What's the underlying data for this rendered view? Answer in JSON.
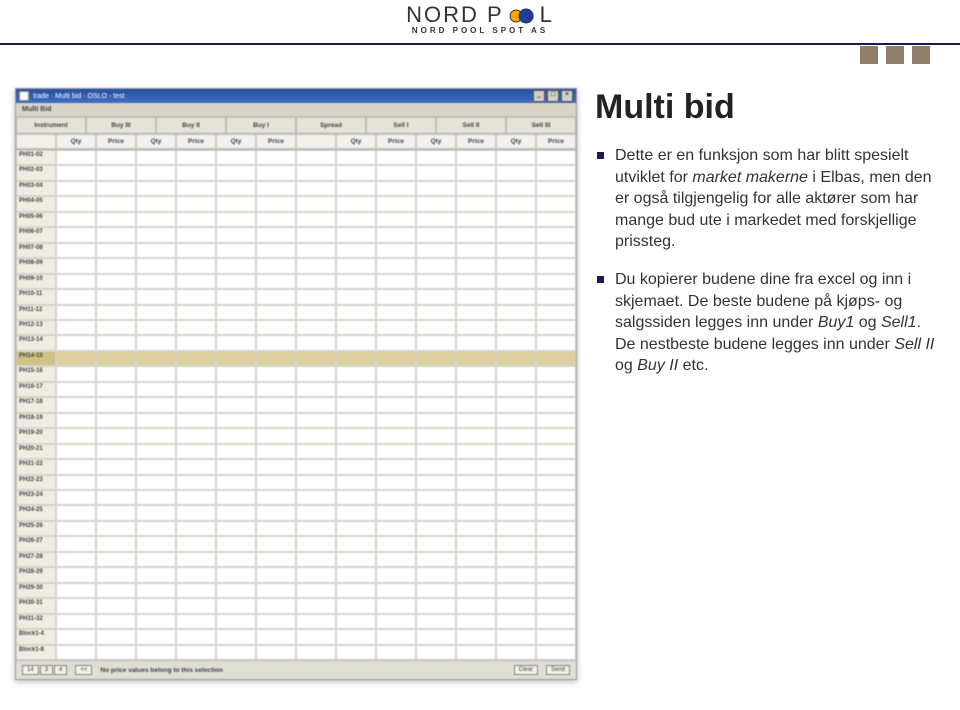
{
  "brand": {
    "name": "NORD POOL",
    "subtitle": "NORD POOL SPOT AS"
  },
  "app": {
    "title": "trade · Multi bid · OSLO - test",
    "menu": "Multi Bid",
    "headers": [
      "Instrument",
      "Buy III",
      "Buy II",
      "Buy I",
      "Spread",
      "Sell I",
      "Sell II",
      "Sell III"
    ],
    "subhead": [
      "",
      "Qty",
      "Price",
      "Qty",
      "Price",
      "Qty",
      "Price",
      "",
      "Qty",
      "Price",
      "Qty",
      "Price",
      "Qty",
      "Price"
    ],
    "rows": [
      "PH01-02",
      "PH02-03",
      "PH03-04",
      "PH04-05",
      "PH05-06",
      "PH06-07",
      "PH07-08",
      "PH08-09",
      "PH09-10",
      "PH10-11",
      "PH11-12",
      "PH12-13",
      "PH13-14",
      "PH14-15",
      "PH15-16",
      "PH16-17",
      "PH17-18",
      "PH18-19",
      "PH19-20",
      "PH20-21",
      "PH21-22",
      "PH22-23",
      "PH23-24",
      "PH24-25",
      "PH25-26",
      "PH26-27",
      "PH27-28",
      "PH28-29",
      "PH29-30",
      "PH30-31",
      "PH31-32",
      "Block1-4",
      "Block1-8"
    ],
    "highlight_index": 13,
    "footer_btns": [
      "14",
      "3",
      "4"
    ],
    "footer_msg": "No price values belong to this selection",
    "footer_right": "Clear",
    "footer_right2": "Send"
  },
  "body": {
    "title": "Multi bid",
    "para1_a": "Dette er en funksjon som har blitt spesielt utviklet for ",
    "para1_em1": "market makerne",
    "para1_b": " i Elbas, men den er også tilgjengelig for alle aktører som har mange bud ute i markedet med forskjellige prissteg.",
    "para2_a": "Du kopierer budene dine fra excel og inn i skjemaet. De beste budene på kjøps- og salgssiden legges inn under ",
    "para2_em2a": "Buy1",
    "para2_mid": " og ",
    "para2_em2b": "Sell1",
    "para2_b": ". De nestbeste budene legges inn under ",
    "para2_em3a": "Sell II",
    "para2_mid2": " og ",
    "para2_em3b": "Buy II",
    "para2_c": " etc."
  }
}
